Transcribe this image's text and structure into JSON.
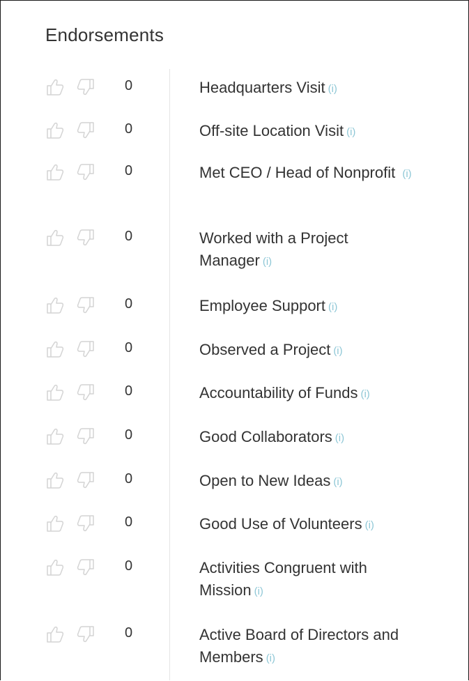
{
  "title": "Endorsements",
  "info_label": "(i)",
  "items": [
    {
      "label": "Headquarters Visit",
      "count": "0"
    },
    {
      "label": "Off-site Location Visit",
      "count": "0"
    },
    {
      "label": "Met CEO / Head of Nonprofit",
      "count": "0"
    },
    {
      "label": "Worked with a Project Manager",
      "count": "0"
    },
    {
      "label": "Employee Support",
      "count": "0"
    },
    {
      "label": "Observed a Project",
      "count": "0"
    },
    {
      "label": "Accountability of Funds",
      "count": "0"
    },
    {
      "label": "Good Collaborators",
      "count": "0"
    },
    {
      "label": "Open to New Ideas",
      "count": "0"
    },
    {
      "label": "Good Use of Volunteers",
      "count": "0"
    },
    {
      "label": "Activities Congruent with Mission",
      "count": "0"
    },
    {
      "label": "Active Board of Directors and Members",
      "count": "0"
    }
  ],
  "colors": {
    "text": "#333333",
    "icon": "#d4d4d4",
    "info": "#8ec7d6",
    "divider": "#e4e4e4"
  }
}
